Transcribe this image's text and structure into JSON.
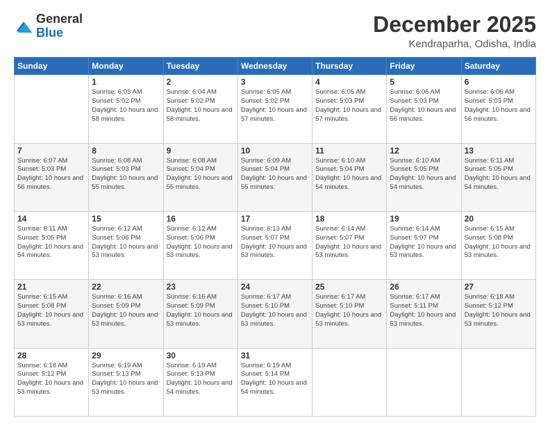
{
  "header": {
    "logo_general": "General",
    "logo_blue": "Blue",
    "month_title": "December 2025",
    "location": "Kendraparha, Odisha, India"
  },
  "weekdays": [
    "Sunday",
    "Monday",
    "Tuesday",
    "Wednesday",
    "Thursday",
    "Friday",
    "Saturday"
  ],
  "weeks": [
    [
      {
        "day": "",
        "sunrise": "",
        "sunset": "",
        "daylight": ""
      },
      {
        "day": "1",
        "sunrise": "Sunrise: 6:03 AM",
        "sunset": "Sunset: 5:02 PM",
        "daylight": "Daylight: 10 hours and 58 minutes."
      },
      {
        "day": "2",
        "sunrise": "Sunrise: 6:04 AM",
        "sunset": "Sunset: 5:02 PM",
        "daylight": "Daylight: 10 hours and 58 minutes."
      },
      {
        "day": "3",
        "sunrise": "Sunrise: 6:05 AM",
        "sunset": "Sunset: 5:02 PM",
        "daylight": "Daylight: 10 hours and 57 minutes."
      },
      {
        "day": "4",
        "sunrise": "Sunrise: 6:05 AM",
        "sunset": "Sunset: 5:03 PM",
        "daylight": "Daylight: 10 hours and 57 minutes."
      },
      {
        "day": "5",
        "sunrise": "Sunrise: 6:06 AM",
        "sunset": "Sunset: 5:03 PM",
        "daylight": "Daylight: 10 hours and 56 minutes."
      },
      {
        "day": "6",
        "sunrise": "Sunrise: 6:06 AM",
        "sunset": "Sunset: 5:03 PM",
        "daylight": "Daylight: 10 hours and 56 minutes."
      }
    ],
    [
      {
        "day": "7",
        "sunrise": "Sunrise: 6:07 AM",
        "sunset": "Sunset: 5:03 PM",
        "daylight": "Daylight: 10 hours and 56 minutes."
      },
      {
        "day": "8",
        "sunrise": "Sunrise: 6:08 AM",
        "sunset": "Sunset: 5:03 PM",
        "daylight": "Daylight: 10 hours and 55 minutes."
      },
      {
        "day": "9",
        "sunrise": "Sunrise: 6:08 AM",
        "sunset": "Sunset: 5:04 PM",
        "daylight": "Daylight: 10 hours and 55 minutes."
      },
      {
        "day": "10",
        "sunrise": "Sunrise: 6:09 AM",
        "sunset": "Sunset: 5:04 PM",
        "daylight": "Daylight: 10 hours and 55 minutes."
      },
      {
        "day": "11",
        "sunrise": "Sunrise: 6:10 AM",
        "sunset": "Sunset: 5:04 PM",
        "daylight": "Daylight: 10 hours and 54 minutes."
      },
      {
        "day": "12",
        "sunrise": "Sunrise: 6:10 AM",
        "sunset": "Sunset: 5:05 PM",
        "daylight": "Daylight: 10 hours and 54 minutes."
      },
      {
        "day": "13",
        "sunrise": "Sunrise: 6:11 AM",
        "sunset": "Sunset: 5:05 PM",
        "daylight": "Daylight: 10 hours and 54 minutes."
      }
    ],
    [
      {
        "day": "14",
        "sunrise": "Sunrise: 6:11 AM",
        "sunset": "Sunset: 5:05 PM",
        "daylight": "Daylight: 10 hours and 54 minutes."
      },
      {
        "day": "15",
        "sunrise": "Sunrise: 6:12 AM",
        "sunset": "Sunset: 5:06 PM",
        "daylight": "Daylight: 10 hours and 53 minutes."
      },
      {
        "day": "16",
        "sunrise": "Sunrise: 6:12 AM",
        "sunset": "Sunset: 5:06 PM",
        "daylight": "Daylight: 10 hours and 53 minutes."
      },
      {
        "day": "17",
        "sunrise": "Sunrise: 6:13 AM",
        "sunset": "Sunset: 5:07 PM",
        "daylight": "Daylight: 10 hours and 53 minutes."
      },
      {
        "day": "18",
        "sunrise": "Sunrise: 6:14 AM",
        "sunset": "Sunset: 5:07 PM",
        "daylight": "Daylight: 10 hours and 53 minutes."
      },
      {
        "day": "19",
        "sunrise": "Sunrise: 6:14 AM",
        "sunset": "Sunset: 5:07 PM",
        "daylight": "Daylight: 10 hours and 53 minutes."
      },
      {
        "day": "20",
        "sunrise": "Sunrise: 6:15 AM",
        "sunset": "Sunset: 5:08 PM",
        "daylight": "Daylight: 10 hours and 53 minutes."
      }
    ],
    [
      {
        "day": "21",
        "sunrise": "Sunrise: 6:15 AM",
        "sunset": "Sunset: 5:08 PM",
        "daylight": "Daylight: 10 hours and 53 minutes."
      },
      {
        "day": "22",
        "sunrise": "Sunrise: 6:16 AM",
        "sunset": "Sunset: 5:09 PM",
        "daylight": "Daylight: 10 hours and 53 minutes."
      },
      {
        "day": "23",
        "sunrise": "Sunrise: 6:16 AM",
        "sunset": "Sunset: 5:09 PM",
        "daylight": "Daylight: 10 hours and 53 minutes."
      },
      {
        "day": "24",
        "sunrise": "Sunrise: 6:17 AM",
        "sunset": "Sunset: 5:10 PM",
        "daylight": "Daylight: 10 hours and 53 minutes."
      },
      {
        "day": "25",
        "sunrise": "Sunrise: 6:17 AM",
        "sunset": "Sunset: 5:10 PM",
        "daylight": "Daylight: 10 hours and 53 minutes."
      },
      {
        "day": "26",
        "sunrise": "Sunrise: 6:17 AM",
        "sunset": "Sunset: 5:11 PM",
        "daylight": "Daylight: 10 hours and 53 minutes."
      },
      {
        "day": "27",
        "sunrise": "Sunrise: 6:18 AM",
        "sunset": "Sunset: 5:12 PM",
        "daylight": "Daylight: 10 hours and 53 minutes."
      }
    ],
    [
      {
        "day": "28",
        "sunrise": "Sunrise: 6:18 AM",
        "sunset": "Sunset: 5:12 PM",
        "daylight": "Daylight: 10 hours and 53 minutes."
      },
      {
        "day": "29",
        "sunrise": "Sunrise: 6:19 AM",
        "sunset": "Sunset: 5:13 PM",
        "daylight": "Daylight: 10 hours and 53 minutes."
      },
      {
        "day": "30",
        "sunrise": "Sunrise: 6:19 AM",
        "sunset": "Sunset: 5:13 PM",
        "daylight": "Daylight: 10 hours and 54 minutes."
      },
      {
        "day": "31",
        "sunrise": "Sunrise: 6:19 AM",
        "sunset": "Sunset: 5:14 PM",
        "daylight": "Daylight: 10 hours and 54 minutes."
      },
      {
        "day": "",
        "sunrise": "",
        "sunset": "",
        "daylight": ""
      },
      {
        "day": "",
        "sunrise": "",
        "sunset": "",
        "daylight": ""
      },
      {
        "day": "",
        "sunrise": "",
        "sunset": "",
        "daylight": ""
      }
    ]
  ]
}
